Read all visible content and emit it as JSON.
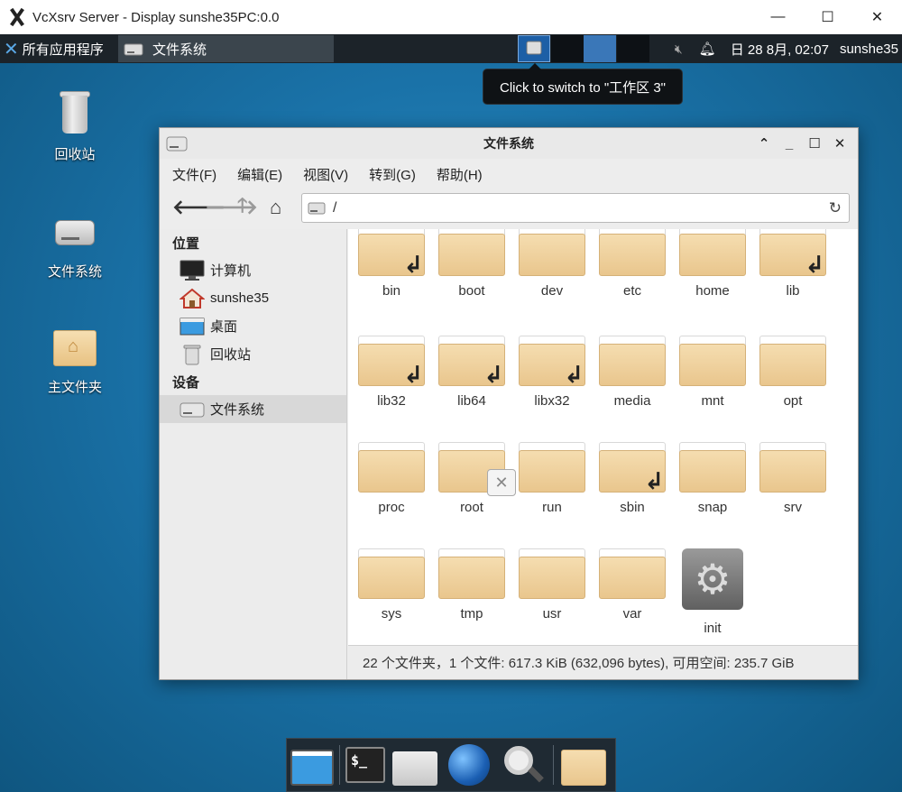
{
  "host_window": {
    "title": "VcXsrv Server - Display sunshe35PC:0.0",
    "minimize": "—",
    "maximize": "☐",
    "close": "✕"
  },
  "panel": {
    "apps_label": "所有应用程序",
    "task_label": "文件系统",
    "date_time": "日 28 8月, 02:07",
    "user": "sunshe35"
  },
  "tooltip": "Click to switch to \"工作区 3\"",
  "desktop": {
    "icons": [
      {
        "name": "回收站"
      },
      {
        "name": "文件系统"
      },
      {
        "name": "主文件夹"
      }
    ]
  },
  "file_manager": {
    "title": "文件系统",
    "controls": {
      "up": "⌃",
      "minimize": "_",
      "maximize": "☐",
      "close": "✕"
    },
    "menu": [
      "文件(F)",
      "编辑(E)",
      "视图(V)",
      "转到(G)",
      "帮助(H)"
    ],
    "location": "/",
    "sidebar": {
      "places_header": "位置",
      "places": [
        "计算机",
        "sunshe35",
        "桌面",
        "回收站"
      ],
      "devices_header": "设备",
      "devices": [
        "文件系统"
      ]
    },
    "files": [
      {
        "name": "bin",
        "type": "link"
      },
      {
        "name": "boot",
        "type": "folder"
      },
      {
        "name": "dev",
        "type": "folder"
      },
      {
        "name": "etc",
        "type": "folder"
      },
      {
        "name": "home",
        "type": "folder"
      },
      {
        "name": "lib",
        "type": "link"
      },
      {
        "name": "lib32",
        "type": "link"
      },
      {
        "name": "lib64",
        "type": "link"
      },
      {
        "name": "libx32",
        "type": "link"
      },
      {
        "name": "media",
        "type": "folder"
      },
      {
        "name": "mnt",
        "type": "folder"
      },
      {
        "name": "opt",
        "type": "folder"
      },
      {
        "name": "proc",
        "type": "folder"
      },
      {
        "name": "root",
        "type": "locked"
      },
      {
        "name": "run",
        "type": "folder"
      },
      {
        "name": "sbin",
        "type": "link"
      },
      {
        "name": "snap",
        "type": "folder"
      },
      {
        "name": "srv",
        "type": "folder"
      },
      {
        "name": "sys",
        "type": "folder"
      },
      {
        "name": "tmp",
        "type": "folder"
      },
      {
        "name": "usr",
        "type": "folder"
      },
      {
        "name": "var",
        "type": "folder"
      },
      {
        "name": "init",
        "type": "executable"
      }
    ],
    "status": "22 个文件夹，1 个文件: 617.3 KiB (632,096 bytes), 可用空间: 235.7 GiB"
  },
  "dock": {
    "terminal_glyph": "$_"
  }
}
